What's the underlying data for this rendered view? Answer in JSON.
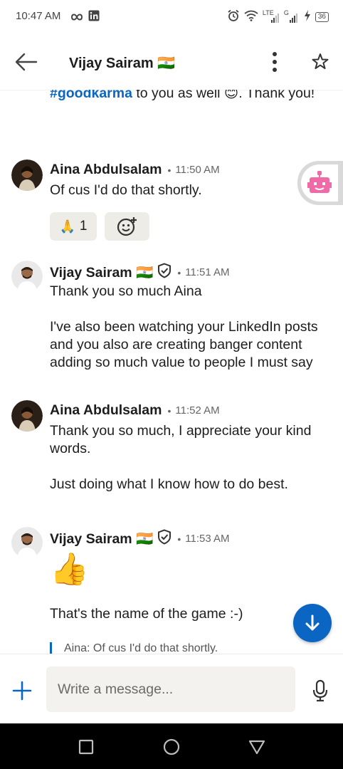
{
  "status_bar": {
    "time": "10:47 AM",
    "left_icons": [
      "infinity-icon",
      "linkedin-icon"
    ],
    "right_icons": [
      "alarm-icon",
      "wifi-icon",
      "lte-signal-icon",
      "signal-icon",
      "charging-icon"
    ],
    "network_label": "LTE",
    "network_label_2": "G",
    "battery": "36"
  },
  "header": {
    "contact_name": "Vijay Sairam 🇮🇳",
    "icons": [
      "back-arrow-icon",
      "more-vert-icon",
      "star-icon"
    ]
  },
  "conversation": {
    "previous_text_tail": {
      "hashtag": "#goodkarma",
      "text": " to you as well 😊. Thank you!"
    },
    "messages": [
      {
        "sender": "Aina Abdulsalam",
        "time": "11:50 AM",
        "verified": false,
        "paragraphs": [
          "Of cus I'd do that shortly."
        ],
        "reactions": [
          {
            "emoji": "🙏",
            "count": "1"
          }
        ]
      },
      {
        "sender": "Vijay Sairam 🇮🇳",
        "time": "11:51 AM",
        "verified": true,
        "paragraphs": [
          "Thank you so much Aina",
          "I've also been watching your LinkedIn posts and you also are creating banger content adding so much value to people I must say"
        ]
      },
      {
        "sender": "Aina Abdulsalam",
        "time": "11:52 AM",
        "verified": false,
        "paragraphs": [
          "Thank you so much, I appreciate your kind words.",
          "Just doing what I know how to do best."
        ]
      },
      {
        "sender": "Vijay Sairam 🇮🇳",
        "time": "11:53 AM",
        "verified": true,
        "emoji": "👍",
        "paragraphs": [
          "That's the name of the game :-)"
        ],
        "quote": "Aina: Of cus I'd do that shortly."
      }
    ],
    "separator": "•"
  },
  "composer": {
    "placeholder": "Write a message...",
    "icons": [
      "plus-icon",
      "microphone-icon"
    ]
  },
  "nav_bar": {
    "icons": [
      "recents-square-icon",
      "home-circle-icon",
      "back-triangle-icon"
    ]
  },
  "colors": {
    "accent": "#0a66c2",
    "text": "#1d1d1d",
    "muted": "#666666",
    "pill": "#eeece7",
    "input_bg": "#f3f2ee",
    "nav_bg": "#000000"
  }
}
